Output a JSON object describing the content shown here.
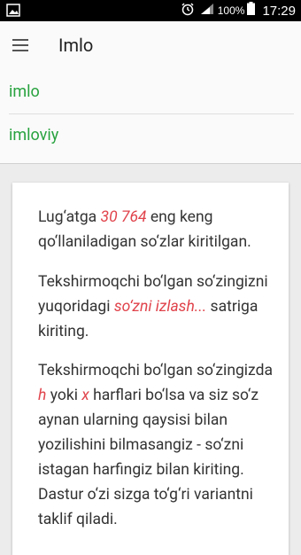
{
  "status_bar": {
    "battery": "100%",
    "time": "17:29"
  },
  "toolbar": {
    "title": "Imlo"
  },
  "suggestions": [
    {
      "label": "imlo"
    },
    {
      "label": "imloviy"
    }
  ],
  "info": {
    "p1_before": "Lug‘atga ",
    "p1_count": "30 764",
    "p1_after": " eng keng qo‘llaniladigan so‘zlar kiritilgan.",
    "p2_before": "Tekshirmoqchi bo‘lgan so‘zingizni yuqoridagi ",
    "p2_link": "so‘zni izlash...",
    "p2_after": " satriga kiriting.",
    "p3_before": "Tekshirmoqchi bo‘lgan so‘zingizda ",
    "p3_h": "h",
    "p3_mid": " yoki ",
    "p3_x": "x",
    "p3_after": " harflari bo‘lsa va siz so‘z aynan ularning qaysisi bilan yozilishini bilmasangiz - so‘zni istagan harfingiz bilan kiriting. Dastur o‘zi sizga to‘g‘ri variantni taklif qiladi."
  },
  "colors": {
    "accent_green": "#27a23e",
    "highlight_red": "#e0434b"
  }
}
